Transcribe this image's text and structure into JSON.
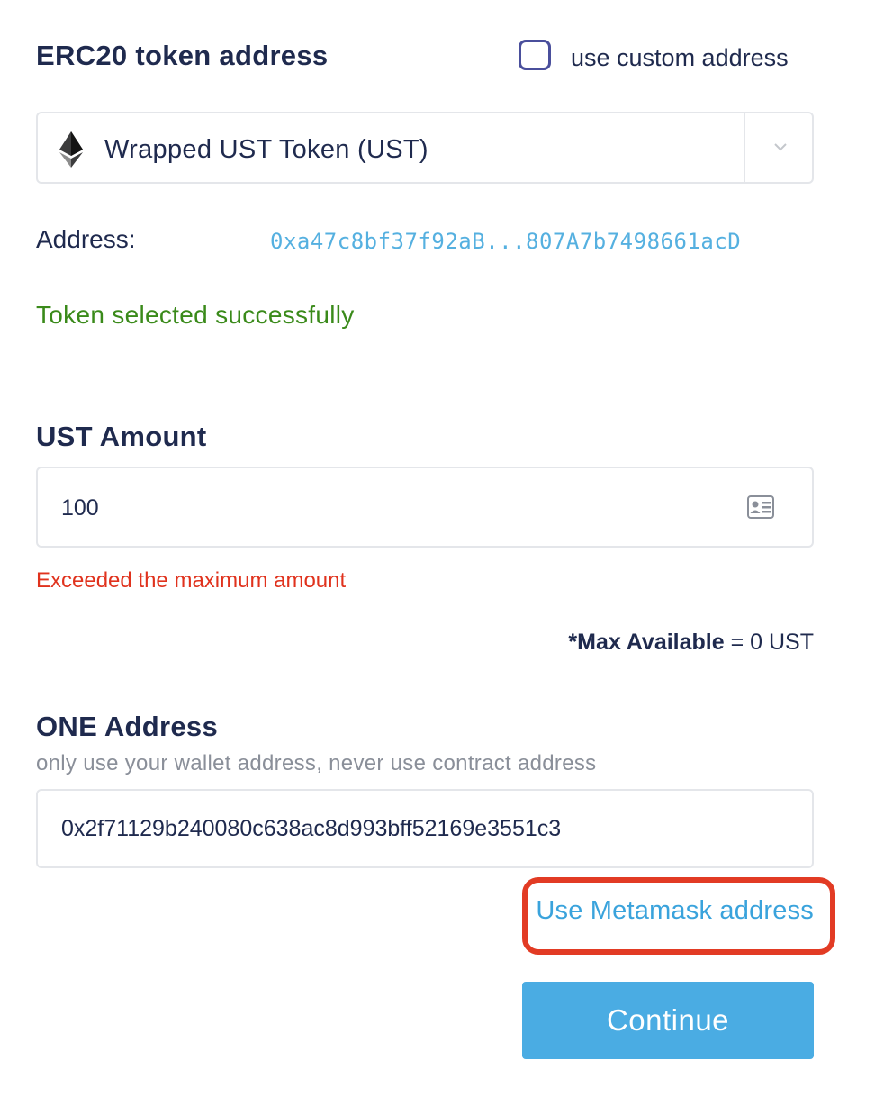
{
  "erc20": {
    "title": "ERC20 token address",
    "custom_address_label": "use custom address",
    "custom_address_checked": false,
    "selected_token": "Wrapped UST Token (UST)",
    "token_icon": "ethereum-icon",
    "address_label": "Address:",
    "address_value": "0xa47c8bf37f92aB...807A7b7498661acD",
    "status_message": "Token selected successfully"
  },
  "amount": {
    "title": "UST Amount",
    "value": "100",
    "error_message": "Exceeded the maximum amount",
    "max_label": "*Max Available",
    "max_value": " = 0 UST"
  },
  "one_address": {
    "title": "ONE Address",
    "hint": "only use your wallet address, never use contract address",
    "value": "0x2f71129b240080c638ac8d993bff52169e3551c3",
    "metamask_link": "Use Metamask address"
  },
  "actions": {
    "continue_label": "Continue"
  },
  "colors": {
    "accent": "#4aace3",
    "link": "#3aa3dc",
    "success": "#3a8a1a",
    "error": "#e0321d",
    "highlight": "#e23b24"
  }
}
